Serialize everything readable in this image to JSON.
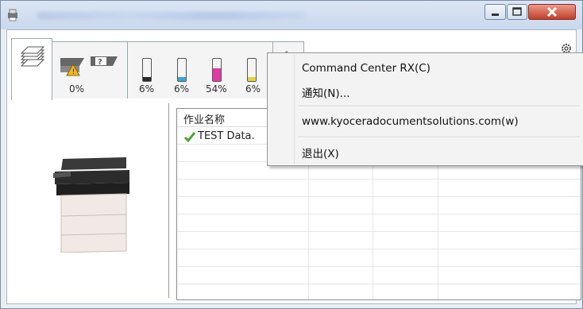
{
  "tabs": {
    "toner_values": [
      "0%",
      "6%",
      "6%",
      "54%",
      "6%"
    ]
  },
  "list": {
    "column_header": "作业名称",
    "rows": [
      {
        "name": "TEST Data.",
        "status_icon": "check-icon"
      }
    ]
  },
  "context_menu": {
    "items": [
      "Command Center RX(C)",
      "通知(N)...",
      "www.kyoceradocumentsolutions.com(w)",
      "退出(X)"
    ]
  },
  "toner_levels": {
    "black": 0.06,
    "cyan": 0.06,
    "magenta": 0.54,
    "yellow": 0.06
  },
  "colors": {
    "black_toner": "#2b2b2b",
    "cyan_toner": "#3aa6d8",
    "magenta_toner": "#e23aa5",
    "yellow_toner": "#e6d23a",
    "close_button": "#c1402a"
  }
}
